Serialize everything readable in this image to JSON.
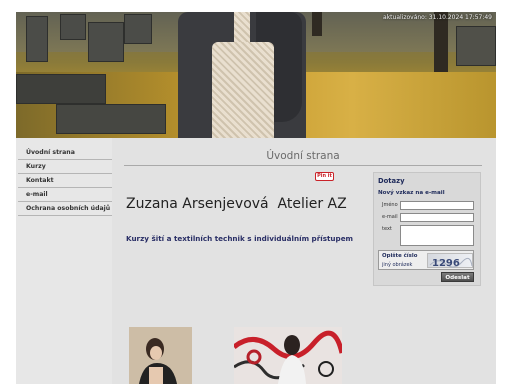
{
  "header": {
    "updated_text": "aktualizováno: 31.10.2024 17:57:49"
  },
  "nav": {
    "items": [
      {
        "label": "Úvodní strana"
      },
      {
        "label": "Kurzy"
      },
      {
        "label": "Kontakt"
      },
      {
        "label": "e-mail"
      },
      {
        "label": "Ochrana osobních údajů"
      }
    ]
  },
  "main": {
    "page_title": "Úvodní strana",
    "pinit_label": "Pin it",
    "site_name": "Zuzana Arsenjevová  Atelier AZ",
    "tagline": "Kurzy šití a textilních technik s individuálním přístupem"
  },
  "contact_form": {
    "title": "Dotazy",
    "subtitle": "Nový vzkaz na e-mail",
    "name_label": "Jméno",
    "email_label": "e-mail",
    "text_label": "text",
    "captcha_title": "Opište číslo",
    "captcha_other": "jiný obrázek",
    "captcha_code": "1296",
    "submit_label": "Odeslat"
  },
  "colors": {
    "band": "#e7e7e7",
    "content": "#e2e2e2",
    "tagline": "#2a2f66",
    "pinit": "#c92228"
  },
  "icons": {
    "pinit": "pinterest-pin-icon"
  }
}
